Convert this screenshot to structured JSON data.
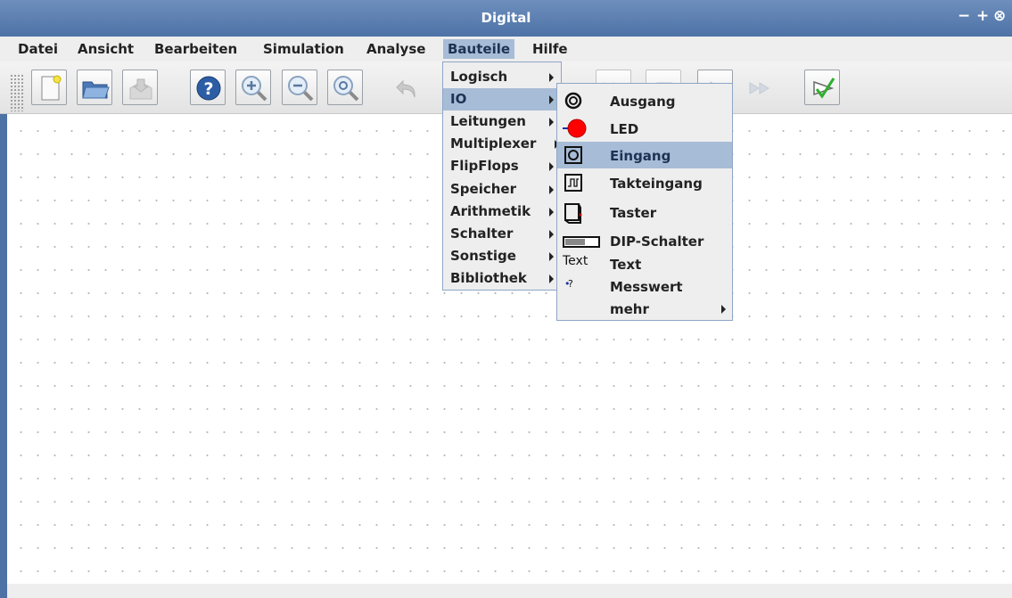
{
  "window": {
    "title": "Digital",
    "controls": [
      "−",
      "+",
      "⊗"
    ]
  },
  "menubar": {
    "items": [
      {
        "label": "Datei"
      },
      {
        "label": "Ansicht"
      },
      {
        "label": "Bearbeiten"
      },
      {
        "label": "Simulation"
      },
      {
        "label": "Analyse"
      },
      {
        "label": "Bauteile"
      },
      {
        "label": "Hilfe"
      }
    ],
    "active": "Bauteile"
  },
  "toolbar": {
    "buttons": [
      {
        "icon": "new-file-icon",
        "enabled": true
      },
      {
        "icon": "open-folder-icon",
        "enabled": true
      },
      {
        "icon": "save-icon",
        "enabled": false
      },
      {
        "icon": "help-icon",
        "enabled": true
      },
      {
        "icon": "zoom-in-icon",
        "enabled": true
      },
      {
        "icon": "zoom-out-icon",
        "enabled": true
      },
      {
        "icon": "zoom-fit-icon",
        "enabled": true
      },
      {
        "icon": "undo-icon",
        "enabled": false
      },
      {
        "icon": "run-icon",
        "enabled": false
      },
      {
        "icon": "fast-forward-icon",
        "enabled": false
      },
      {
        "icon": "stop-icon",
        "enabled": false
      },
      {
        "icon": "step-icon",
        "enabled": false
      },
      {
        "icon": "run-to-break-icon",
        "enabled": false
      },
      {
        "icon": "check-icon",
        "enabled": true
      }
    ]
  },
  "bauteile_menu": {
    "items": [
      {
        "label": "Logisch"
      },
      {
        "label": "IO"
      },
      {
        "label": "Leitungen"
      },
      {
        "label": "Multiplexer"
      },
      {
        "label": "FlipFlops"
      },
      {
        "label": "Speicher"
      },
      {
        "label": "Arithmetik"
      },
      {
        "label": "Schalter"
      },
      {
        "label": "Sonstige"
      },
      {
        "label": "Bibliothek"
      }
    ],
    "highlighted": "IO"
  },
  "io_submenu": {
    "items": [
      {
        "label": "Ausgang",
        "icon": "output-icon"
      },
      {
        "label": "LED",
        "icon": "led-icon"
      },
      {
        "label": "Eingang",
        "icon": "input-icon"
      },
      {
        "label": "Takteingang",
        "icon": "clock-input-icon"
      },
      {
        "label": "Taster",
        "icon": "button-component-icon"
      },
      {
        "label": "DIP-Schalter",
        "icon": "dip-switch-icon"
      },
      {
        "label": "Text",
        "icon": "text-icon",
        "icon_text": "Text"
      },
      {
        "label": "Messwert",
        "icon": "probe-icon",
        "icon_text": "?"
      },
      {
        "label": "mehr",
        "icon": ""
      }
    ],
    "highlighted": "Eingang"
  },
  "colors": {
    "title_bar": "#4d72a6",
    "menu_highlight": "#a7bcd6",
    "led": "#ff0000"
  }
}
